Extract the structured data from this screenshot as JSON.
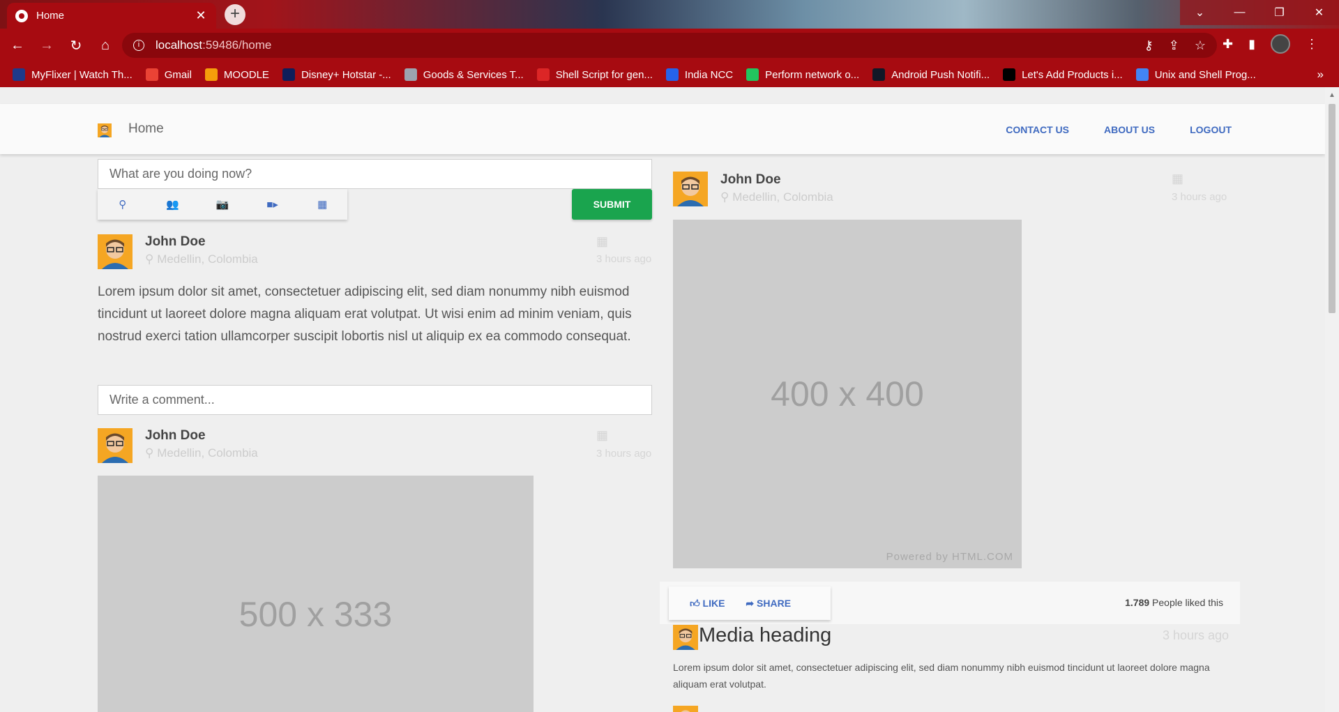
{
  "browser": {
    "tab_title": "Home",
    "url_host": "localhost",
    "url_rest": ":59486/home",
    "bookmarks": [
      {
        "label": "MyFlixer | Watch Th...",
        "color": "#1e3a8a"
      },
      {
        "label": "Gmail",
        "color": "#ea4335"
      },
      {
        "label": "MOODLE",
        "color": "#f59e0b"
      },
      {
        "label": "Disney+ Hotstar -...",
        "color": "#0f1e5a"
      },
      {
        "label": "Goods & Services T...",
        "color": "#9ca3af"
      },
      {
        "label": "Shell Script for gen...",
        "color": "#dc2626"
      },
      {
        "label": "India NCC",
        "color": "#2563eb"
      },
      {
        "label": "Perform network o...",
        "color": "#22c55e"
      },
      {
        "label": "Android Push Notifi...",
        "color": "#111827"
      },
      {
        "label": "Let's Add Products i...",
        "color": "#000000"
      },
      {
        "label": "Unix and Shell Prog...",
        "color": "#4285f4"
      }
    ]
  },
  "nav": {
    "brand": "Home",
    "links": [
      "CONTACT US",
      "ABOUT US",
      "LOGOUT"
    ]
  },
  "composer": {
    "placeholder": "What are you doing now?",
    "submit": "SUBMIT"
  },
  "post": {
    "name": "John Doe",
    "location": "Medellin, Colombia",
    "time": "3 hours ago",
    "text": "Lorem ipsum dolor sit amet, consectetuer adipiscing elit, sed diam nonummy nibh euismod tincidunt ut laoreet dolore magna aliquam erat volutpat. Ut wisi enim ad minim veniam, quis nostrud exerci tation ullamcorper suscipit lobortis nisl ut aliquip ex ea commodo consequat."
  },
  "comment": {
    "placeholder": "Write a comment..."
  },
  "image_post_left": {
    "name": "John Doe",
    "location": "Medellin, Colombia",
    "time": "3 hours ago",
    "image_label": "500 x 333"
  },
  "image_post_right": {
    "name": "John Doe",
    "location": "Medellin, Colombia",
    "time": "3 hours ago",
    "image_label": "400 x 400",
    "powered_by": "Powered by HTML.COM"
  },
  "actions": {
    "like": "LIKE",
    "share": "SHARE",
    "likes_count": "1.789",
    "likes_suffix": "People liked this"
  },
  "media": {
    "heading": "Media heading",
    "time": "3 hours ago",
    "text": "Lorem ipsum dolor sit amet, consectetuer adipiscing elit, sed diam nonummy nibh euismod tincidunt ut laoreet dolore magna aliquam erat volutpat."
  },
  "colors": {
    "chrome": "#a70b11",
    "accent": "#3f6ac0",
    "submit": "#1aa44e"
  }
}
